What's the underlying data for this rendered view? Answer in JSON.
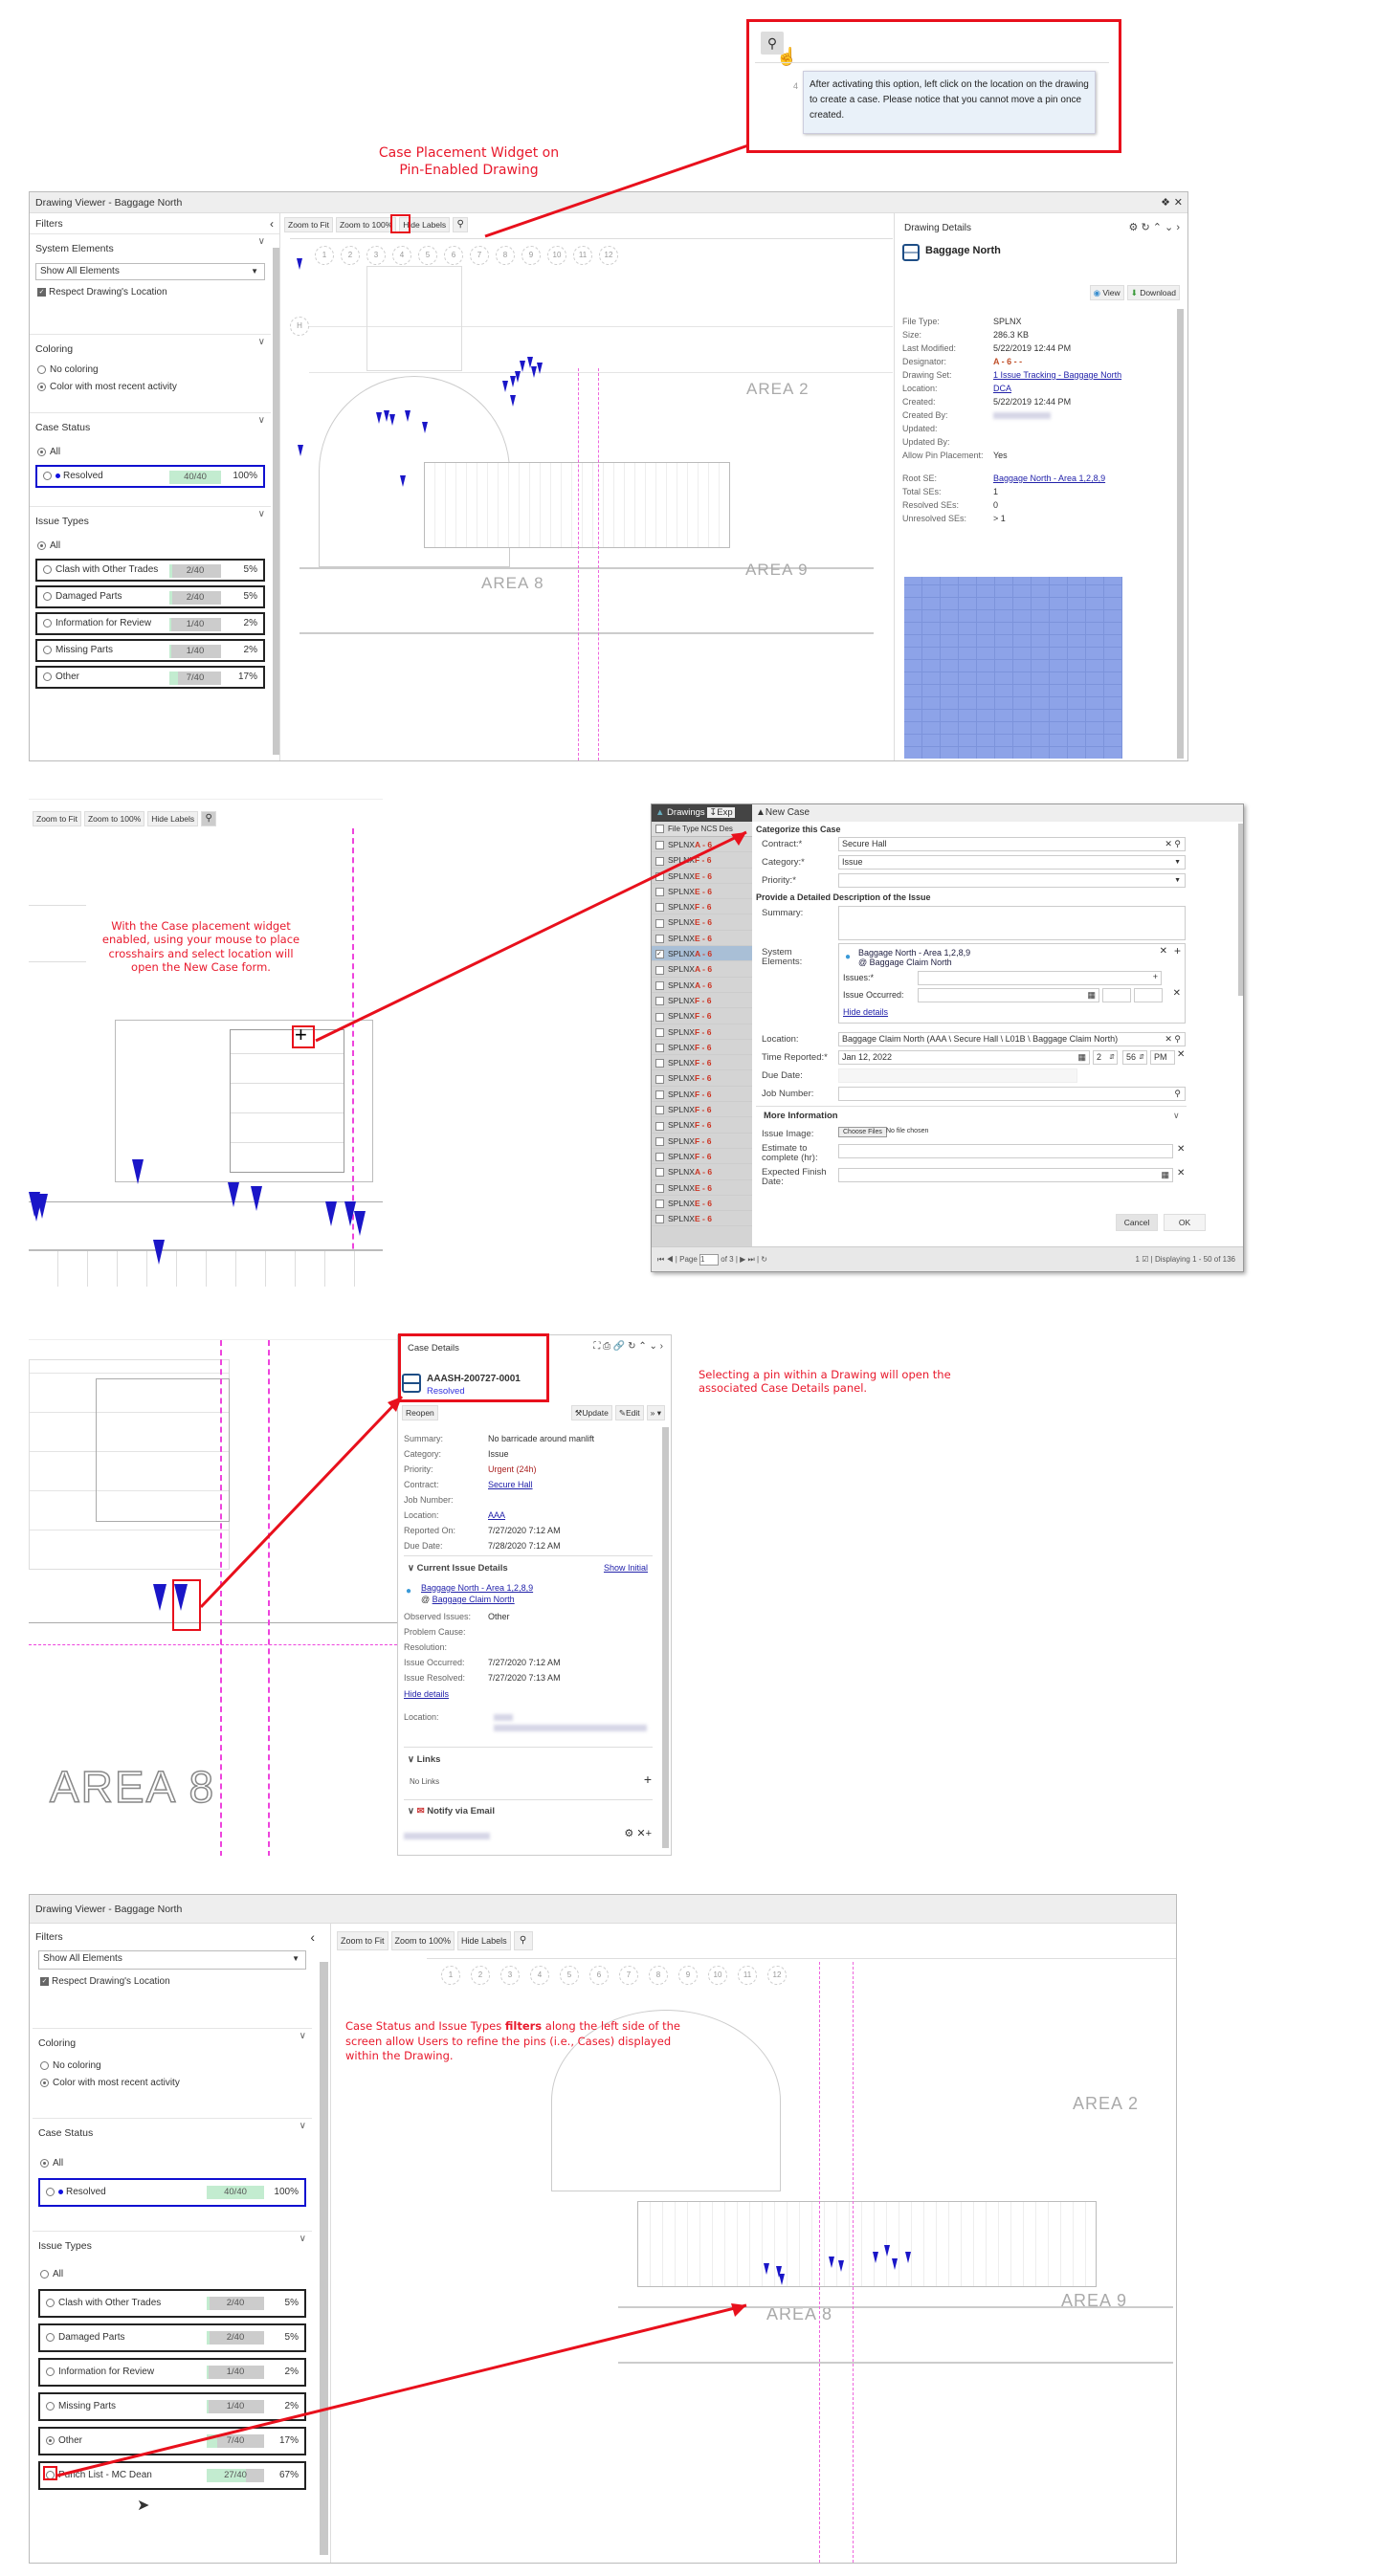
{
  "callouts": {
    "top": "Case Placement Widget on\nPin-Enabled Drawing",
    "crosshair": "With the Case placement widget enabled, using your mouse to place crosshairs and select location will open the New Case form.",
    "pin_select": "Selecting a pin within a Drawing will open the associated Case Details panel.",
    "filters_pre": "Case Status and Issue Types ",
    "filters_bold": "filters",
    "filters_post": " along the left side of the screen allow Users to refine the pins (i.e., Cases) displayed within the Drawing."
  },
  "tooltip": {
    "text": "After activating this option, left click on the location on the drawing to create a case. Please notice that you cannot move a pin once created.",
    "grid_num": "4"
  },
  "viewer": {
    "title": "Drawing Viewer - Baggage North",
    "filters_label": "Filters",
    "system_elements": {
      "title": "System Elements",
      "select_value": "Show All Elements",
      "respect_location": "Respect Drawing's Location",
      "respect_checked": true
    },
    "coloring": {
      "title": "Coloring",
      "options": [
        "No coloring",
        "Color with most recent activity"
      ],
      "selected": 1
    },
    "case_status": {
      "title": "Case Status",
      "all_label": "All",
      "rows": [
        {
          "label": "Resolved",
          "count": "40/40",
          "pct": "100%",
          "fraction": 1.0,
          "dot_color": "#1010e0"
        }
      ]
    },
    "issue_types": {
      "title": "Issue Types",
      "all_label": "All",
      "rows": [
        {
          "label": "Clash with Other Trades",
          "count": "2/40",
          "pct": "5%",
          "fraction": 0.05
        },
        {
          "label": "Damaged Parts",
          "count": "2/40",
          "pct": "5%",
          "fraction": 0.05
        },
        {
          "label": "Information for Review",
          "count": "1/40",
          "pct": "2%",
          "fraction": 0.025
        },
        {
          "label": "Missing Parts",
          "count": "1/40",
          "pct": "2%",
          "fraction": 0.025
        },
        {
          "label": "Other",
          "count": "7/40",
          "pct": "17%",
          "fraction": 0.175
        },
        {
          "label": "Punch List - MC Dean",
          "count": "27/40",
          "pct": "67%",
          "fraction": 0.675
        }
      ]
    },
    "toolbar": {
      "zoom_fit": "Zoom to Fit",
      "zoom_100": "Zoom to 100%",
      "hide_labels": "Hide Labels",
      "pin_icon": "map-pin-icon"
    },
    "grid_numbers": [
      "1",
      "2",
      "3",
      "4",
      "5",
      "6",
      "7",
      "8",
      "9",
      "10",
      "11",
      "12"
    ],
    "grid_letter": "H",
    "areas": [
      "AREA 2",
      "AREA 8",
      "AREA 9"
    ]
  },
  "drawing_details": {
    "title": "Drawing Details",
    "name": "Baggage North",
    "view_label": "View",
    "download_label": "Download",
    "fields": [
      {
        "label": "File Type:",
        "value": "SPLNX"
      },
      {
        "label": "Size:",
        "value": "286.3 KB"
      },
      {
        "label": "Last Modified:",
        "value": "5/22/2019 12:44 PM"
      },
      {
        "label": "Designator:",
        "value": "A - 6 - -"
      },
      {
        "label": "Drawing Set:",
        "value": "1 Issue Tracking - Baggage North",
        "link": true
      },
      {
        "label": "Location:",
        "value": "DCA",
        "link": true
      },
      {
        "label": "Created:",
        "value": "5/22/2019 12:44 PM"
      },
      {
        "label": "Created By:",
        "value": "",
        "blurred": true
      },
      {
        "label": "Updated:",
        "value": ""
      },
      {
        "label": "Updated By:",
        "value": ""
      },
      {
        "label": "Allow Pin Placement:",
        "value": "Yes"
      },
      {
        "label": "Root SE:",
        "value": "Baggage North - Area 1,2,8,9",
        "link": true
      },
      {
        "label": "Total SEs:",
        "value": "1"
      },
      {
        "label": "Resolved SEs:",
        "value": "0"
      },
      {
        "label": "Unresolved SEs:",
        "value": "> 1"
      }
    ]
  },
  "new_case": {
    "tab_drawings": "Drawings",
    "tab_export": "Exp",
    "title": "New Case",
    "grid_headers": [
      "File Type",
      "NCS Des"
    ],
    "grid_rows": [
      {
        "type": "SPLNX",
        "des": "A - 6"
      },
      {
        "type": "SPLNX",
        "des": "F - 6"
      },
      {
        "type": "SPLNX",
        "des": "E - 6"
      },
      {
        "type": "SPLNX",
        "des": "E - 6"
      },
      {
        "type": "SPLNX",
        "des": "F - 6"
      },
      {
        "type": "SPLNX",
        "des": "E - 6"
      },
      {
        "type": "SPLNX",
        "des": "E - 6"
      },
      {
        "type": "SPLNX",
        "des": "A - 6",
        "checked": true
      },
      {
        "type": "SPLNX",
        "des": "A - 6"
      },
      {
        "type": "SPLNX",
        "des": "A - 6"
      },
      {
        "type": "SPLNX",
        "des": "F - 6"
      },
      {
        "type": "SPLNX",
        "des": "F - 6"
      },
      {
        "type": "SPLNX",
        "des": "F - 6"
      },
      {
        "type": "SPLNX",
        "des": "F - 6"
      },
      {
        "type": "SPLNX",
        "des": "F - 6"
      },
      {
        "type": "SPLNX",
        "des": "F - 6"
      },
      {
        "type": "SPLNX",
        "des": "F - 6"
      },
      {
        "type": "SPLNX",
        "des": "F - 6"
      },
      {
        "type": "SPLNX",
        "des": "F - 6"
      },
      {
        "type": "SPLNX",
        "des": "F - 6"
      },
      {
        "type": "SPLNX",
        "des": "F - 6"
      },
      {
        "type": "SPLNX",
        "des": "A - 6"
      },
      {
        "type": "SPLNX",
        "des": "E - 6"
      },
      {
        "type": "SPLNX",
        "des": "E - 6"
      },
      {
        "type": "SPLNX",
        "des": "E - 6"
      }
    ],
    "section1": "Categorize this Case",
    "contract_label": "Contract:*",
    "contract_value": "Secure Hall",
    "category_label": "Category:*",
    "category_value": "Issue",
    "priority_label": "Priority:*",
    "priority_value": "",
    "section2": "Provide a Detailed Description of the Issue",
    "summary_label": "Summary:",
    "system_elements_label": "System Elements:",
    "se_name": "Baggage North - Area 1,2,8,9",
    "se_location": "@ Baggage Claim North",
    "issues_label": "Issues:*",
    "issue_occurred_label": "Issue Occurred:",
    "hide_details": "Hide details",
    "location_label": "Location:",
    "location_value": "Baggage Claim North (AAA \\ Secure Hall \\ L01B \\ Baggage Claim North)",
    "time_reported_label": "Time Reported:*",
    "time_reported_date": "Jan 12, 2022",
    "time_hour": "2",
    "time_min": "56",
    "time_ampm": "PM",
    "due_date_label": "Due Date:",
    "job_number_label": "Job Number:",
    "more_info": "More Information",
    "issue_image_label": "Issue Image:",
    "choose_files": "Choose Files",
    "no_file": "No file chosen",
    "estimate_label": "Estimate to complete (hr):",
    "expected_finish_label": "Expected Finish Date:",
    "cancel": "Cancel",
    "ok": "OK",
    "pager_page": "Page",
    "pager_value": "1",
    "pager_of": "of 3",
    "pager_selected": "1",
    "pager_display": "Displaying 1 - 50 of 136"
  },
  "case_details": {
    "title": "Case Details",
    "case_id": "AAASH-200727-0001",
    "status": "Resolved",
    "reopen": "Reopen",
    "update": "Update",
    "edit": "Edit",
    "more": "»",
    "fields": [
      {
        "label": "Summary:",
        "value": "No barricade around manlift"
      },
      {
        "label": "Category:",
        "value": "Issue"
      },
      {
        "label": "Priority:",
        "value": "Urgent (24h)",
        "color": "#aa2222"
      },
      {
        "label": "Contract:",
        "value": "Secure Hall",
        "link": true
      },
      {
        "label": "Job Number:",
        "value": ""
      },
      {
        "label": "Location:",
        "value": "AAA",
        "link": true
      },
      {
        "label": "Reported On:",
        "value": "7/27/2020 7:12 AM"
      },
      {
        "label": "Due Date:",
        "value": "7/28/2020 7:12 AM"
      }
    ],
    "current_issue": "Current Issue Details",
    "show_initial": "Show Initial",
    "se_name": "Baggage North - Area 1,2,8,9",
    "se_at": "@ ",
    "se_location": "Baggage Claim North",
    "issue_fields": [
      {
        "label": "Observed Issues:",
        "value": "Other"
      },
      {
        "label": "Problem Cause:",
        "value": ""
      },
      {
        "label": "Resolution:",
        "value": ""
      },
      {
        "label": "Issue Occurred:",
        "value": "7/27/2020 7:12 AM"
      },
      {
        "label": "Issue Resolved:",
        "value": "7/27/2020 7:13 AM"
      }
    ],
    "hide_details": "Hide details",
    "location_label": "Location:",
    "links_title": "Links",
    "no_links": "No Links",
    "notify_title": "Notify via Email"
  }
}
